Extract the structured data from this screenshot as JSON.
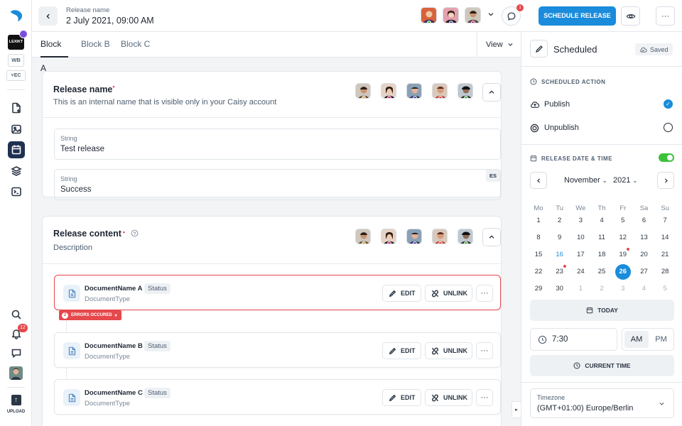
{
  "header": {
    "release_label": "Release name",
    "release_date": "2 July 2021, 09:00 AM",
    "schedule_label": "SCHEDULE RELEASE",
    "notification_count": "1"
  },
  "sidebar": {
    "org_label": "LEXIKT",
    "ws_label": "WB",
    "branch_label": "EC",
    "notifications_count": "12",
    "upload_label": "UPLOAD"
  },
  "tabs": [
    {
      "label": "Block A"
    },
    {
      "label": "Block B"
    },
    {
      "label": "Block C"
    }
  ],
  "view_label": "View",
  "release_name_card": {
    "title": "Release name",
    "description": "This is an internal name that is visible only in your Caisy account",
    "fields": [
      {
        "label": "String",
        "value": "Test release"
      },
      {
        "label": "String",
        "value": "Success",
        "locale": "ES"
      }
    ]
  },
  "release_content_card": {
    "title": "Release content",
    "description": "Description",
    "errors_label": "ERRORS OCCURED",
    "errors_count": "2",
    "documents": [
      {
        "name": "DocumentName A",
        "status": "Status",
        "type": "DocumentType"
      },
      {
        "name": "DocumentName B",
        "status": "Status",
        "type": "DocumentType"
      },
      {
        "name": "DocumentName C",
        "status": "Status",
        "type": "DocumentType"
      }
    ],
    "edit_label": "EDIT",
    "unlink_label": "UNLINK"
  },
  "panel": {
    "title": "Scheduled",
    "saved_label": "Saved",
    "action_heading": "SCHEDULED ACTION",
    "actions": [
      {
        "label": "Publish",
        "selected": true
      },
      {
        "label": "Unpublish",
        "selected": false
      }
    ],
    "date_heading": "RELEASE DATE & TIME",
    "month": "November",
    "year": "2021",
    "weekdays": [
      "Mo",
      "Tu",
      "We",
      "Th",
      "Fr",
      "Sa",
      "Su"
    ],
    "weeks": [
      [
        "1",
        "2",
        "3",
        "4",
        "5",
        "6",
        "7"
      ],
      [
        "8",
        "9",
        "10",
        "11",
        "12",
        "13",
        "14"
      ],
      [
        "15",
        "16",
        "17",
        "18",
        "19",
        "20",
        "21"
      ],
      [
        "22",
        "23",
        "24",
        "25",
        "26",
        "27",
        "28"
      ],
      [
        "29",
        "30",
        "1",
        "2",
        "3",
        "4",
        "5"
      ]
    ],
    "today_label": "TODAY",
    "time_value": "7:30",
    "am_label": "AM",
    "pm_label": "PM",
    "current_time_label": "CURRENT TIME",
    "timezone_label": "Timezone",
    "timezone_value": "(GMT+01:00) Europe/Berlin"
  },
  "colors": {
    "accent": "#1a8cdb",
    "error": "#e5484d",
    "toggle_on": "#3cc13b",
    "sidebar_active": "#1f3150"
  },
  "presence_dots": [
    "#f5a623",
    "#e91e8c",
    "#5b3fd6",
    "#e5484d",
    "#3cc13b"
  ]
}
